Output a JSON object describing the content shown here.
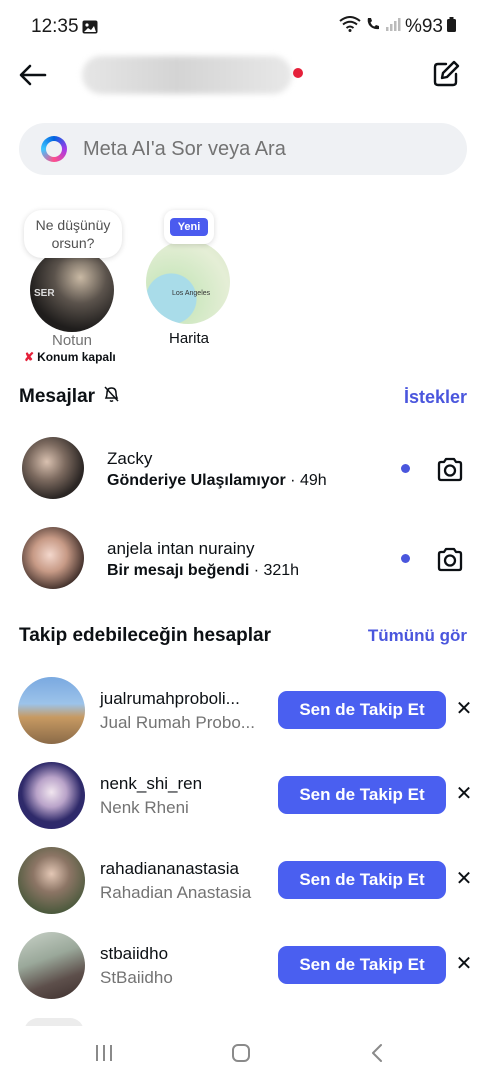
{
  "status_bar": {
    "time": "12:35",
    "battery": "%93"
  },
  "header": {
    "back_icon": "arrow-left-icon",
    "compose_icon": "edit-icon"
  },
  "search": {
    "placeholder": "Meta AI'a Sor veya Ara"
  },
  "notes": {
    "note_prompt": "Ne düşünüyorsun?",
    "note_prompt_line1": "Ne düşünüy",
    "note_prompt_line2": "orsun?",
    "note_label": "Notun",
    "location_status": "Konum kapalı",
    "map_badge": "Yeni",
    "map_label": "Harita",
    "map_place": "Los Angeles"
  },
  "messages": {
    "title": "Mesajlar",
    "requests_link": "İstekler",
    "items": [
      {
        "name": "Zacky",
        "preview": "Gönderiye Ulaşılamıyor",
        "time": " · 49h",
        "unread": true
      },
      {
        "name": "anjela intan nurainy",
        "preview": "Bir mesajı beğendi",
        "time": " · 321h",
        "unread": true
      }
    ]
  },
  "suggestions": {
    "title": "Takip edebileceğin hesaplar",
    "see_all": "Tümünü gör",
    "follow_label": "Sen de Takip Et",
    "dismiss_label": "✕",
    "items": [
      {
        "handle": "jualrumahproboli...",
        "name": "Jual Rumah Probo..."
      },
      {
        "handle": "nenk_shi_ren",
        "name": "Nenk Rheni"
      },
      {
        "handle": "rahadiananastasia",
        "name": "Rahadian Anastasia"
      },
      {
        "handle": "stbaiidho",
        "name": "StBaiidho"
      }
    ]
  },
  "colors": {
    "accent": "#4a5ff0",
    "link": "#4a56dd",
    "unread_dot": "#4a56dd",
    "alert_red": "#e5203a"
  }
}
